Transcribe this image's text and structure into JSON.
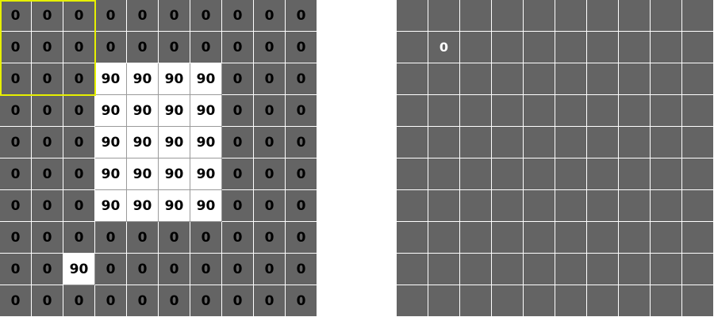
{
  "colors": {
    "dark_cell": "#646464",
    "light_cell": "#ffffff",
    "window_border": "#e6f000",
    "input_text": "#000000",
    "output_text": "#ffffff"
  },
  "input_grid": {
    "rows": [
      [
        "0",
        "0",
        "0",
        "0",
        "0",
        "0",
        "0",
        "0",
        "0",
        "0"
      ],
      [
        "0",
        "0",
        "0",
        "0",
        "0",
        "0",
        "0",
        "0",
        "0",
        "0"
      ],
      [
        "0",
        "0",
        "0",
        "90",
        "90",
        "90",
        "90",
        "0",
        "0",
        "0"
      ],
      [
        "0",
        "0",
        "0",
        "90",
        "90",
        "90",
        "90",
        "0",
        "0",
        "0"
      ],
      [
        "0",
        "0",
        "0",
        "90",
        "90",
        "90",
        "90",
        "0",
        "0",
        "0"
      ],
      [
        "0",
        "0",
        "0",
        "90",
        "90",
        "90",
        "90",
        "0",
        "0",
        "0"
      ],
      [
        "0",
        "0",
        "0",
        "90",
        "90",
        "90",
        "90",
        "0",
        "0",
        "0"
      ],
      [
        "0",
        "0",
        "0",
        "0",
        "0",
        "0",
        "0",
        "0",
        "0",
        "0"
      ],
      [
        "0",
        "0",
        "90",
        "0",
        "0",
        "0",
        "0",
        "0",
        "0",
        "0"
      ],
      [
        "0",
        "0",
        "0",
        "0",
        "0",
        "0",
        "0",
        "0",
        "0",
        "0"
      ]
    ]
  },
  "output_grid": {
    "rows": [
      [
        "",
        "",
        "",
        "",
        "",
        "",
        "",
        "",
        "",
        ""
      ],
      [
        "",
        "0",
        "",
        "",
        "",
        "",
        "",
        "",
        "",
        ""
      ],
      [
        "",
        "",
        "",
        "",
        "",
        "",
        "",
        "",
        "",
        ""
      ],
      [
        "",
        "",
        "",
        "",
        "",
        "",
        "",
        "",
        "",
        ""
      ],
      [
        "",
        "",
        "",
        "",
        "",
        "",
        "",
        "",
        "",
        ""
      ],
      [
        "",
        "",
        "",
        "",
        "",
        "",
        "",
        "",
        "",
        ""
      ],
      [
        "",
        "",
        "",
        "",
        "",
        "",
        "",
        "",
        "",
        ""
      ],
      [
        "",
        "",
        "",
        "",
        "",
        "",
        "",
        "",
        "",
        ""
      ],
      [
        "",
        "",
        "",
        "",
        "",
        "",
        "",
        "",
        "",
        ""
      ],
      [
        "",
        "",
        "",
        "",
        "",
        "",
        "",
        "",
        "",
        ""
      ]
    ]
  }
}
